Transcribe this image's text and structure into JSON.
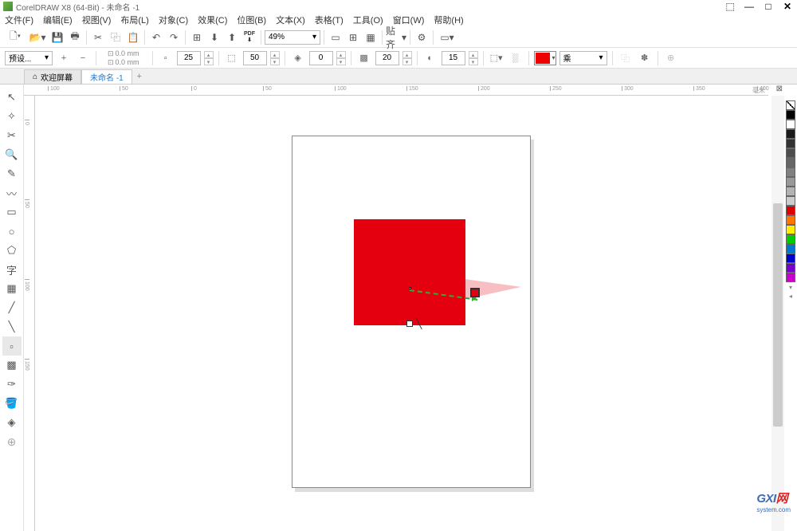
{
  "title_bar": {
    "title": "CorelDRAW X8 (64-Bit) - 未命名 -1",
    "icons": {
      "restore_small": "⬚",
      "min": "—",
      "max": "□",
      "close": "✕"
    }
  },
  "menu": {
    "items": [
      "文件(F)",
      "编辑(E)",
      "视图(V)",
      "布局(L)",
      "对象(C)",
      "效果(C)",
      "位图(B)",
      "文本(X)",
      "表格(T)",
      "工具(O)",
      "窗口(W)",
      "帮助(H)"
    ]
  },
  "toolbar1": {
    "zoom": "49%",
    "snap_label": "贴齐"
  },
  "toolbar2": {
    "preset": "预设...",
    "x_val": "0.0 mm",
    "y_val": "0.0 mm",
    "val1": "25",
    "val2": "50",
    "val3": "0",
    "val4": "20",
    "val5": "15",
    "blend_mode": "乘"
  },
  "tabs": {
    "welcome": "欢迎屏幕",
    "doc": "未命名 -1"
  },
  "rulers": {
    "h_ticks": [
      "100",
      "50",
      "0",
      "50",
      "100",
      "150",
      "200",
      "250",
      "300",
      "350",
      "400"
    ],
    "v_ticks": [
      "0",
      "50",
      "100",
      "150"
    ],
    "unit": "毫米"
  },
  "palette_colors": [
    "#000000",
    "#ffffff",
    "#1a1a1a",
    "#333333",
    "#4d4d4d",
    "#666666",
    "#808080",
    "#999999",
    "#b3b3b3",
    "#cccccc",
    "#e00000",
    "#ff7700",
    "#ffee00",
    "#00cc00",
    "#0077cc",
    "#0000cc",
    "#7700cc",
    "#cc00cc"
  ],
  "watermark": {
    "main": "GXI",
    "net": "网",
    "sub": "system.com"
  }
}
